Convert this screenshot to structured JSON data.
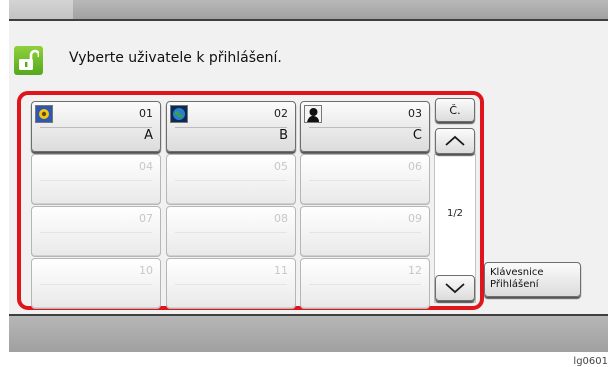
{
  "header": {
    "icon": "unlock-icon",
    "title": "Vyberte uživatele k přihlášení."
  },
  "users": [
    {
      "number": "01",
      "name": "A",
      "avatar": "flower-avatar"
    },
    {
      "number": "02",
      "name": "B",
      "avatar": "globe-avatar"
    },
    {
      "number": "03",
      "name": "C",
      "avatar": "silhouette-avatar"
    },
    {
      "number": "04",
      "name": ""
    },
    {
      "number": "05",
      "name": ""
    },
    {
      "number": "06",
      "name": ""
    },
    {
      "number": "07",
      "name": ""
    },
    {
      "number": "08",
      "name": ""
    },
    {
      "number": "09",
      "name": ""
    },
    {
      "number": "10",
      "name": ""
    },
    {
      "number": "11",
      "name": ""
    },
    {
      "number": "12",
      "name": ""
    }
  ],
  "side": {
    "number_label": "Č.",
    "page_indicator": "1/2"
  },
  "keyboard_button": {
    "line1": "Klávesnice",
    "line2": "Přihlášení"
  },
  "figure_ref": "lg0601",
  "colors": {
    "highlight_frame": "#e0141b",
    "lock_icon": "#6cbf2a"
  }
}
